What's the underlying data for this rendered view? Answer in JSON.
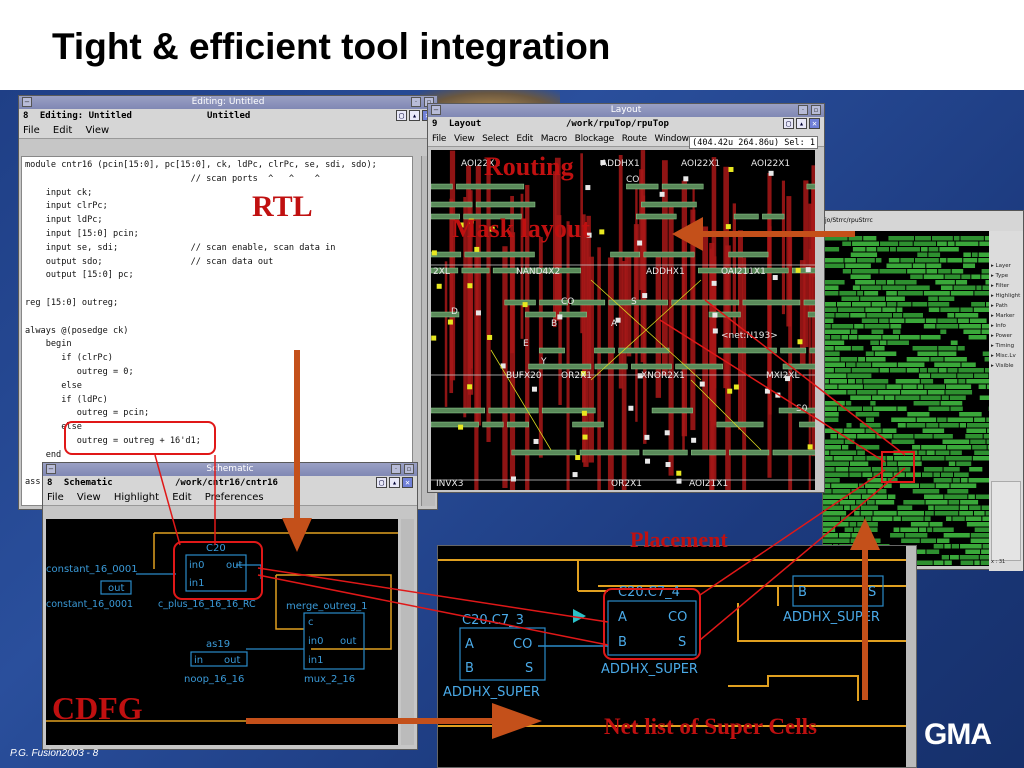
{
  "slide": {
    "title": "Tight & efficient tool integration",
    "footer": "P.G. Fusion2003 -  8",
    "logo": "GMA"
  },
  "annotations": {
    "rtl": "RTL",
    "routing": "Routing",
    "mask_layout": "Mask layout",
    "placement": "Placement",
    "cdfg": "CDFG",
    "netlist": "Net list of Super Cells"
  },
  "rtl_window": {
    "title": "Editing: Untitled",
    "header_num": "8",
    "header_left": "Editing: Untitled",
    "header_right": "Untitled",
    "menu": [
      "File",
      "Edit",
      "View"
    ],
    "code": "module cntr16 (pcin[15:0], pc[15:0], ck, ldPc, clrPc, se, sdi, sdo);\n                                // scan ports  ^   ^    ^\n    input ck;\n    input clrPc;\n    input ldPc;\n    input [15:0] pcin;\n    input se, sdi;              // scan enable, scan data in\n    output sdo;                 // scan data out\n    output [15:0] pc;\n\nreg [15:0] outreg;\n\nalways @(posedge ck)\n    begin\n       if (clrPc)\n          outreg = 0;\n       else\n       if (ldPc)\n          outreg = pcin;\n       else\n          outreg = outreg + 16'd1;\n    end\n\nass\n\nend"
  },
  "layout_window": {
    "title": "Layout",
    "header_num": "9",
    "header_left": "Layout",
    "header_path": "/work/rpuTop/rpuTop",
    "menu": [
      "File",
      "View",
      "Select",
      "Edit",
      "Macro",
      "Blockage",
      "Route",
      "Window"
    ],
    "coord": "(404.42u 264.86u)  Sel: 1",
    "cell_labels": [
      "AOI22X1",
      "ADDHX1",
      "AOI22X1",
      "AOI22X1",
      "CO",
      "NAND4X2",
      "ADDHX1",
      "OAI211X1",
      "BUFX20",
      "OR2X1",
      "XNOR2X1",
      "MXI2XL",
      "INVX3",
      "OR2X1",
      "AOI21X1",
      "<net:N193>",
      "2XL",
      "A",
      "B",
      "CO",
      "S",
      "Y",
      "D",
      "E",
      "S0"
    ]
  },
  "placement_window": {
    "path": "jo/Strrc/rpuStrrc",
    "panel_items": [
      "Layer",
      "Type",
      "Filter",
      "Highlight",
      "Path",
      "Marker",
      "Info",
      "Power",
      "Timing",
      "Misc.Lv",
      "Visible"
    ],
    "panel_bottom": [
      "Theme",
      "View",
      "Pri"
    ],
    "coord": "x : 31"
  },
  "schematic_window": {
    "title": "Schematic",
    "header_num": "8",
    "header_left": "Schematic",
    "header_path": "/work/cntr16/cntr16",
    "menu": [
      "File",
      "View",
      "Highlight",
      "Edit",
      "Preferences"
    ],
    "blocks": {
      "c20": {
        "name": "C20",
        "in0": "in0",
        "in1": "in1",
        "out": "out"
      },
      "const": {
        "name": "constant_16_0001",
        "port": "out",
        "label": "constant_16_0001"
      },
      "plus": {
        "label": "c_plus_16_16_16_RC"
      },
      "merge": {
        "name": "merge_outreg_1",
        "c": "c",
        "in0": "in0",
        "in1": "in1",
        "out": "out",
        "label": "mux_2_16"
      },
      "as19": {
        "name": "as19",
        "in": "in",
        "out": "out",
        "label": "noop_16_16"
      }
    }
  },
  "netlist_window": {
    "cells": [
      {
        "name": "C20.C7_4",
        "ports": [
          "A",
          "CO",
          "B",
          "S"
        ],
        "label": "ADDHX_SUPER"
      },
      {
        "name": "C20.C7_3",
        "ports": [
          "A",
          "CO",
          "B",
          "S"
        ],
        "label": "ADDHX_SUPER"
      },
      {
        "name": "",
        "ports": [
          "B",
          "S"
        ],
        "label": "ADDHX_SUPER"
      }
    ]
  },
  "colors": {
    "annotation_red": "#c01010",
    "arrow_brown": "#c4501a",
    "highlight_red": "#e01818",
    "wire_orange": "#e0a020",
    "cell_cyan": "#2a8ac8",
    "metal_red": "#a81818",
    "placement_green": "#3aa83a"
  }
}
